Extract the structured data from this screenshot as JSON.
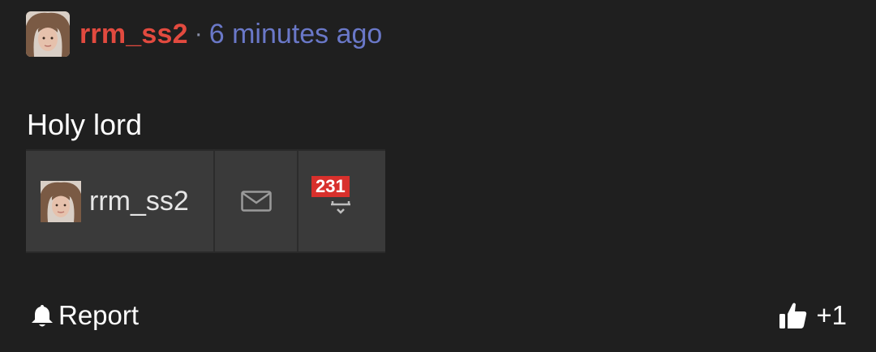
{
  "comment": {
    "author": "rrm_ss2",
    "separator": "·",
    "timestamp": "6 minutes ago",
    "text": "Holy lord"
  },
  "embed": {
    "username": "rrm_ss2",
    "mail_icon": "mail-icon",
    "notification_icon": "bell-icon",
    "notification_count": "231"
  },
  "actions": {
    "report_label": "Report",
    "report_icon": "bell-icon",
    "vote_icon": "thumbs-up-icon",
    "vote_label": "+1"
  },
  "colors": {
    "background": "#1f1f1f",
    "author": "#e24a3f",
    "timestamp": "#6a78c8",
    "badge": "#d8302c"
  }
}
